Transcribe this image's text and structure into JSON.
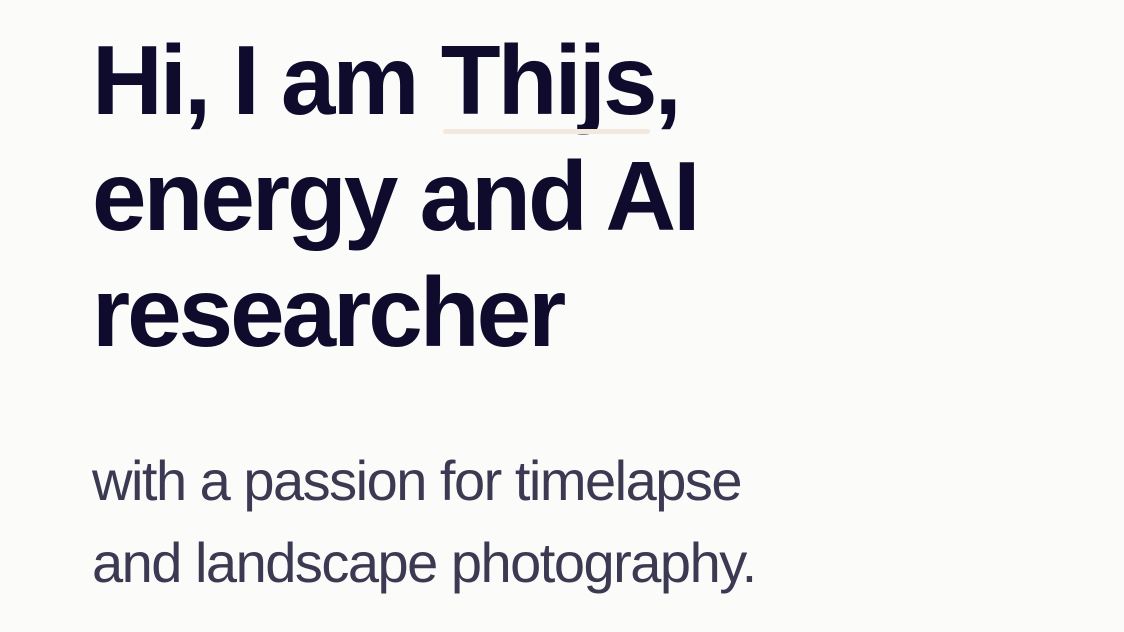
{
  "hero": {
    "headline": {
      "greeting": "Hi, I am ",
      "name": "Thijs",
      "name_suffix": ",",
      "line2": "energy and AI",
      "line3": "researcher"
    },
    "subtitle": {
      "line1": "with a passion for timelapse",
      "line2": "and landscape photography."
    }
  },
  "colors": {
    "background": "#fbfbfa",
    "heading": "#0f0b2c",
    "subtitle": "#3c3a52",
    "name_underline": "#f3e8dd"
  }
}
